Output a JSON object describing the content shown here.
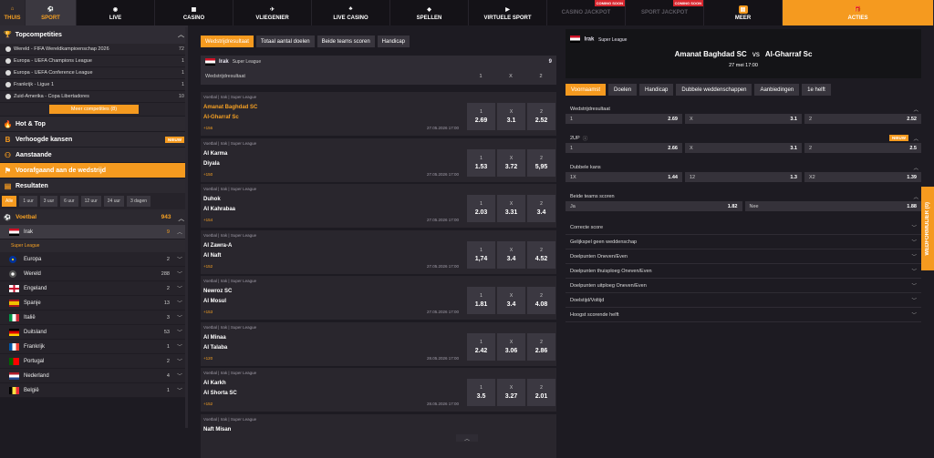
{
  "nav": [
    {
      "label": "THUIS",
      "icon": "home-icon",
      "style": "home"
    },
    {
      "label": "SPORT",
      "icon": "ball-icon",
      "style": "sport"
    },
    {
      "label": "LIVE",
      "icon": "live-icon",
      "style": ""
    },
    {
      "label": "CASINO",
      "icon": "casino-icon",
      "style": ""
    },
    {
      "label": "VLIEGENIER",
      "icon": "plane-icon",
      "style": ""
    },
    {
      "label": "LIVE CASINO",
      "icon": "dealer-icon",
      "style": ""
    },
    {
      "label": "SPELLEN",
      "icon": "games-icon",
      "style": ""
    },
    {
      "label": "VIRTUELE SPORT",
      "icon": "virtual-icon",
      "style": ""
    },
    {
      "label": "CASINO JACKPOT",
      "icon": "",
      "style": "dim",
      "soon": "COMING SOON"
    },
    {
      "label": "SPORT JACKPOT",
      "icon": "",
      "style": "dim",
      "soon": "COMING SOON"
    },
    {
      "label": "MEER",
      "icon": "more-icon",
      "style": "meer"
    },
    {
      "label": "ACTIES",
      "icon": "gift-icon",
      "style": "acties"
    }
  ],
  "sidebar": {
    "top_title": "Topcompetities",
    "top_comps": [
      {
        "name": "Wereld - FIFA Wereldkampioenschap 2026",
        "count": "72"
      },
      {
        "name": "Europa - UEFA Champions League",
        "count": "1"
      },
      {
        "name": "Europa - UEFA Conference League",
        "count": "1"
      },
      {
        "name": "Frankrijk - Ligue 1",
        "count": "1"
      },
      {
        "name": "Zuid-Amerika - Copa Libertadores",
        "count": "10"
      }
    ],
    "more_label": "Meer competities (8)",
    "links": [
      {
        "label": "Hot & Top",
        "icon": "flame-icon"
      },
      {
        "label": "Verhoogde kansen",
        "icon": "boost-icon",
        "badge": "NIEUW"
      },
      {
        "label": "Aanstaande",
        "icon": "clock-icon"
      },
      {
        "label": "Voorafgaand aan de wedstrijd",
        "icon": "calendar-icon",
        "active": true
      },
      {
        "label": "Resultaten",
        "icon": "results-icon"
      }
    ],
    "time_filters": [
      "Alle",
      "1 uur",
      "3 uur",
      "6 uur",
      "12 uur",
      "24 uur",
      "3 dagen"
    ],
    "sport": {
      "label": "Voetbal",
      "count": "943"
    },
    "countries": [
      {
        "name": "Irak",
        "count": "9",
        "flag": "iq",
        "open": true
      },
      {
        "name": "Europa",
        "count": "2",
        "flag": "eu"
      },
      {
        "name": "Wereld",
        "count": "288",
        "flag": "world"
      },
      {
        "name": "Engeland",
        "count": "2",
        "flag": "en"
      },
      {
        "name": "Spanje",
        "count": "13",
        "flag": "es"
      },
      {
        "name": "Italië",
        "count": "3",
        "flag": "it"
      },
      {
        "name": "Duitsland",
        "count": "53",
        "flag": "de"
      },
      {
        "name": "Frankrijk",
        "count": "1",
        "flag": "fr"
      },
      {
        "name": "Portugal",
        "count": "2",
        "flag": "pt"
      },
      {
        "name": "Nederland",
        "count": "4",
        "flag": "nl"
      },
      {
        "name": "België",
        "count": "1",
        "flag": "be"
      }
    ],
    "sub_league": "Super League"
  },
  "middle": {
    "tabs": [
      "Wedstrijdresultaat",
      "Totaal aantal doelen",
      "Beide teams scoren",
      "Handicap"
    ],
    "league": {
      "country": "Irak",
      "name": "Super League",
      "count": "9",
      "market": "Wedstrijdresultaat",
      "cols": [
        "1",
        "X",
        "2"
      ]
    },
    "breadcrumb": "Voetbal | Irak | Super League",
    "matches": [
      {
        "home": "Amanat Baghdad SC",
        "away": "Al-Gharraf Sc",
        "more": "+156",
        "date": "27.05.2026 17:00",
        "odds": [
          "2.69",
          "3.1",
          "2.52"
        ],
        "hl": true
      },
      {
        "home": "Al Karma",
        "away": "Diyala",
        "more": "+150",
        "date": "27.05.2026 17:00",
        "odds": [
          "1.53",
          "3.72",
          "5,95"
        ]
      },
      {
        "home": "Duhok",
        "away": "Al Kahrabaa",
        "more": "+154",
        "date": "27.05.2026 17:00",
        "odds": [
          "2.03",
          "3.31",
          "3.4"
        ]
      },
      {
        "home": "Al Zawra-A",
        "away": "Al Naft",
        "more": "+152",
        "date": "27.05.2026 17:00",
        "odds": [
          "1,74",
          "3.4",
          "4.52"
        ]
      },
      {
        "home": "Newroz SC",
        "away": "Al Mosul",
        "more": "+153",
        "date": "27.05.2026 17:00",
        "odds": [
          "1.81",
          "3.4",
          "4.08"
        ]
      },
      {
        "home": "Al Minaa",
        "away": "Al Talaba",
        "more": "+120",
        "date": "28.05.2026 17:00",
        "odds": [
          "2.42",
          "3.06",
          "2.86"
        ]
      },
      {
        "home": "Al Karkh",
        "away": "Al Shorta SC",
        "more": "+152",
        "date": "28.05.2026 17:00",
        "odds": [
          "3.5",
          "3.27",
          "2.01"
        ]
      },
      {
        "home": "Naft Misan",
        "away": "",
        "more": "",
        "date": "",
        "odds": []
      }
    ]
  },
  "right": {
    "league": {
      "country": "Irak",
      "name": "Super League"
    },
    "home": "Amanat Baghdad SC",
    "vs": "vs",
    "away": "Al-Gharraf Sc",
    "when": "27 mei 17:00",
    "tabs": [
      "Voornaamst",
      "Doelen",
      "Handicap",
      "Dubbele weddenschappen",
      "Aanbiedingen",
      "1e helft"
    ],
    "markets": [
      {
        "title": "Wedstrijdresultaat",
        "cells": [
          {
            "l": "1",
            "v": "2.69"
          },
          {
            "l": "X",
            "v": "3.1"
          },
          {
            "l": "2",
            "v": "2.52"
          }
        ]
      },
      {
        "title": "2UP",
        "info": true,
        "badge": "NIEUW",
        "cells": [
          {
            "l": "1",
            "v": "2.66"
          },
          {
            "l": "X",
            "v": "3.1"
          },
          {
            "l": "2",
            "v": "2.5"
          }
        ]
      },
      {
        "title": "Dubbele kans",
        "cells": [
          {
            "l": "1X",
            "v": "1.44"
          },
          {
            "l": "12",
            "v": "1.3"
          },
          {
            "l": "X2",
            "v": "1.39"
          }
        ]
      },
      {
        "title": "Beide teams scoren",
        "cells": [
          {
            "l": "Ja",
            "v": "1.82"
          },
          {
            "l": "Nee",
            "v": "1.88"
          }
        ]
      }
    ],
    "list": [
      "Correcte score",
      "Gelijkspel geen weddenschap",
      "Doelpunten Oneven/Even",
      "Doelpunten thuisploeg Oneven/Even",
      "Doelpunten uitploeg Oneven/Even",
      "Doelstijd/Voltijd",
      "Hoogst scorende helft"
    ]
  },
  "betslip": "WEDFORMULIER (0)",
  "colors": {
    "accent": "#f59a1f",
    "bg": "#1d1b22",
    "panel": "#29262d"
  }
}
